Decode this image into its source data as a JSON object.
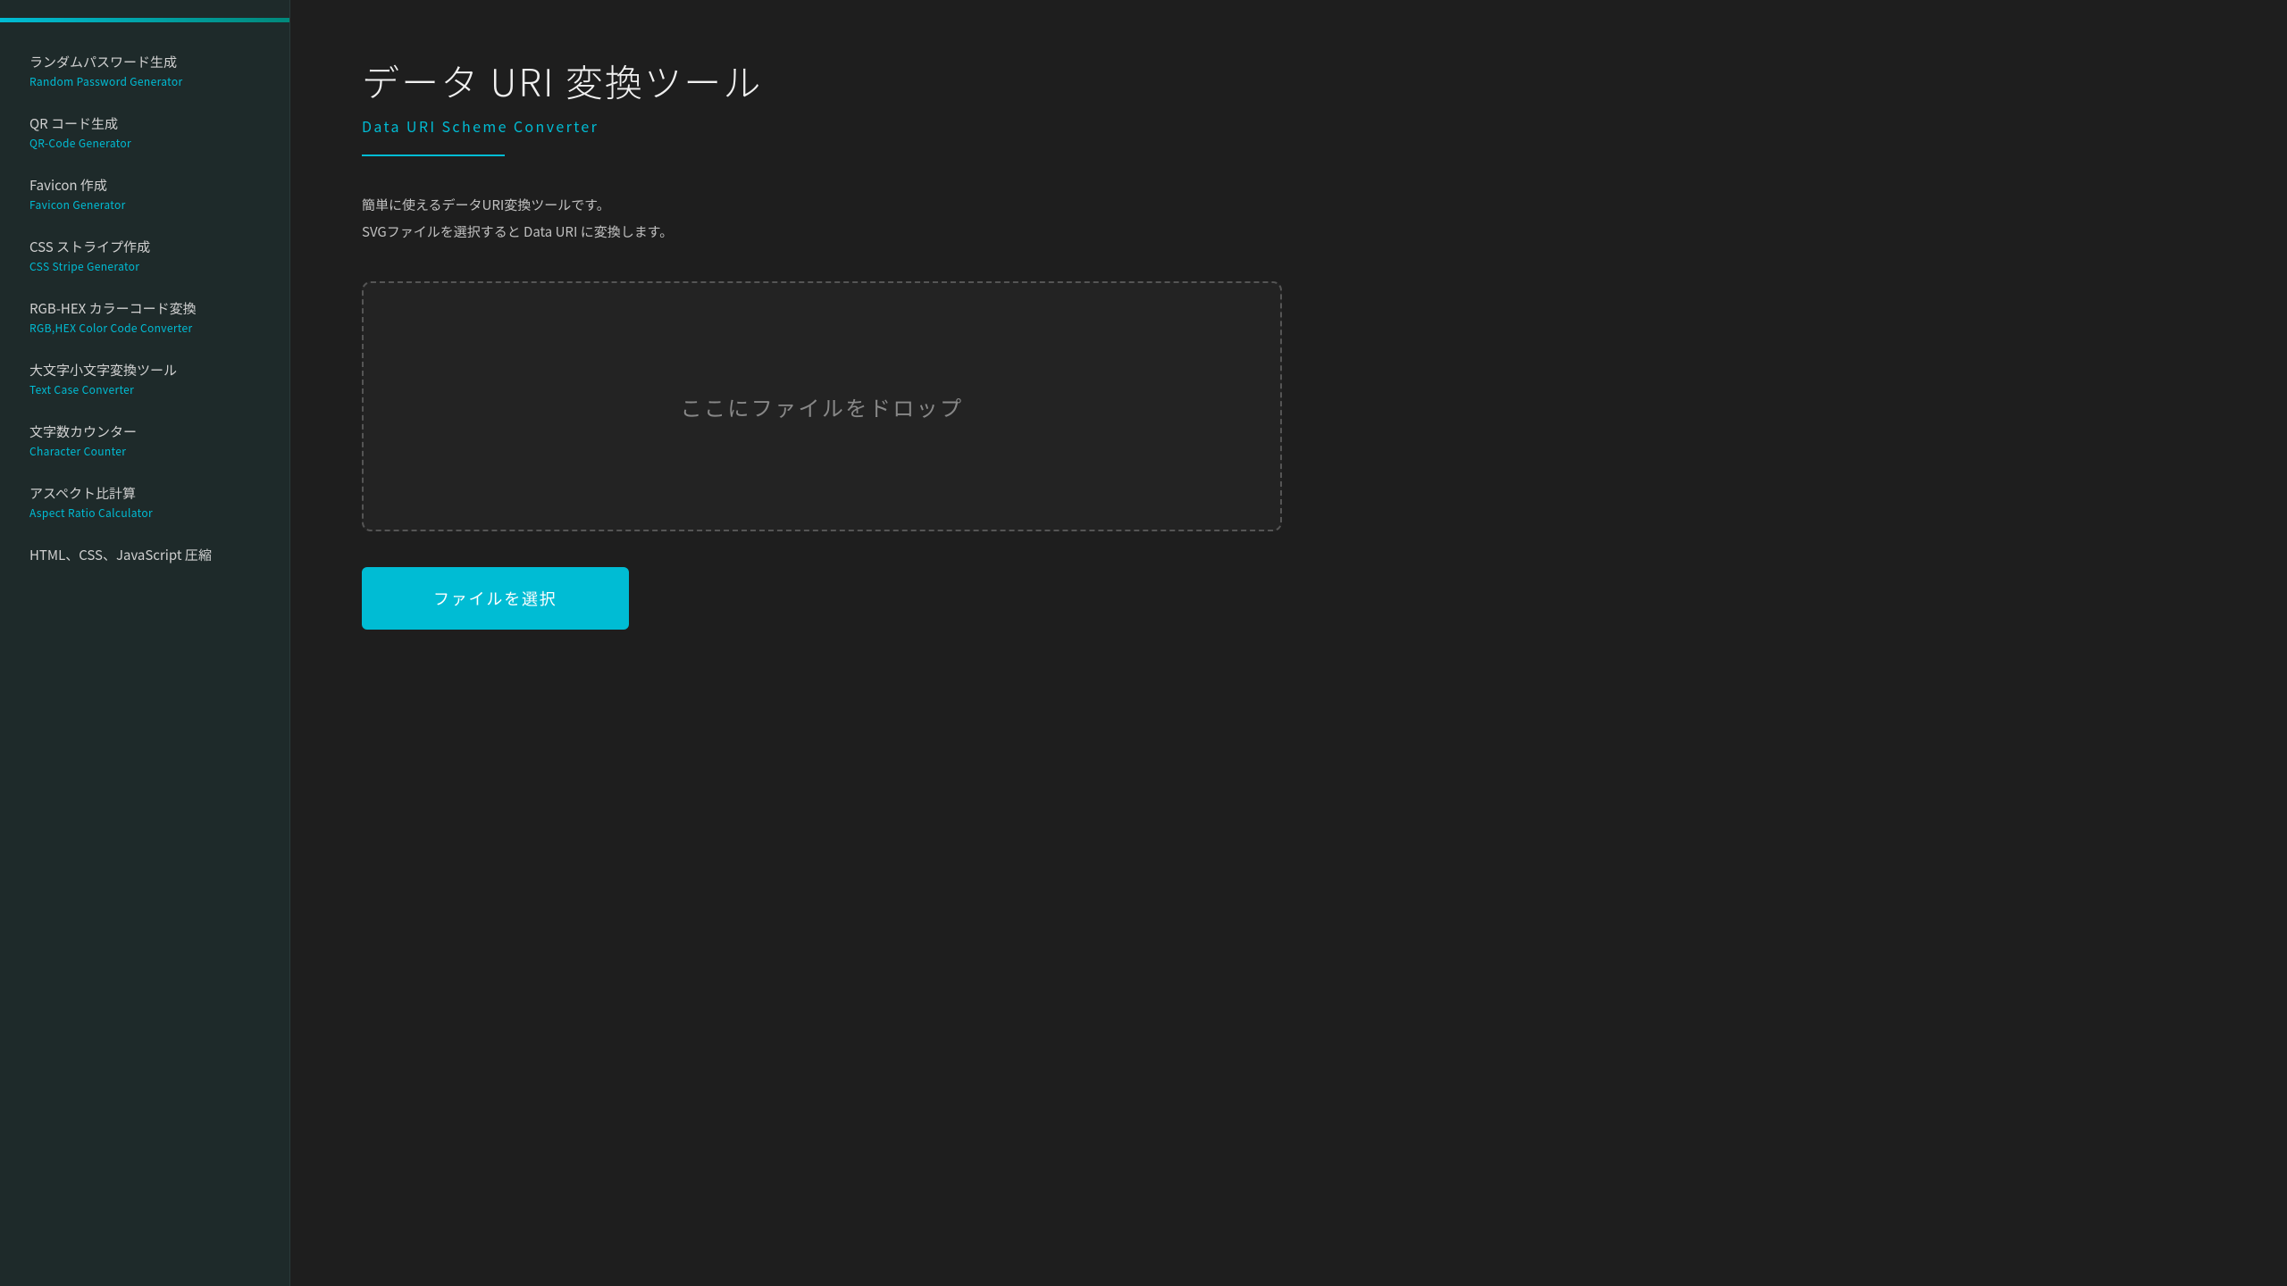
{
  "sidebar": {
    "top_bar": true,
    "items": [
      {
        "ja": "ランダムパスワード生成",
        "en": "Random Password Generator",
        "id": "random-password"
      },
      {
        "ja": "QR コード生成",
        "en": "QR-Code Generator",
        "id": "qr-code"
      },
      {
        "ja": "Favicon 作成",
        "en": "Favicon Generator",
        "id": "favicon"
      },
      {
        "ja": "CSS ストライプ作成",
        "en": "CSS Stripe Generator",
        "id": "css-stripe"
      },
      {
        "ja": "RGB-HEX カラーコード変換",
        "en": "RGB,HEX Color Code Converter",
        "id": "rgb-hex"
      },
      {
        "ja": "大文字小文字変換ツール",
        "en": "Text Case Converter",
        "id": "text-case"
      },
      {
        "ja": "文字数カウンター",
        "en": "Character Counter",
        "id": "char-counter"
      },
      {
        "ja": "アスペクト比計算",
        "en": "Aspect Ratio Calculator",
        "id": "aspect-ratio"
      },
      {
        "ja": "HTML、CSS、JavaScript 圧縮",
        "en": "",
        "id": "minifier"
      }
    ]
  },
  "main": {
    "title_ja": "データ URI 変換ツール",
    "title_en": "Data URI Scheme Converter",
    "description_line1": "簡単に使えるデータURI変換ツールです。",
    "description_line2": "SVGファイルを選択すると Data URI に変換します。",
    "drop_zone_text": "ここにファイルをドロップ",
    "select_button_label": "ファイルを選択"
  }
}
